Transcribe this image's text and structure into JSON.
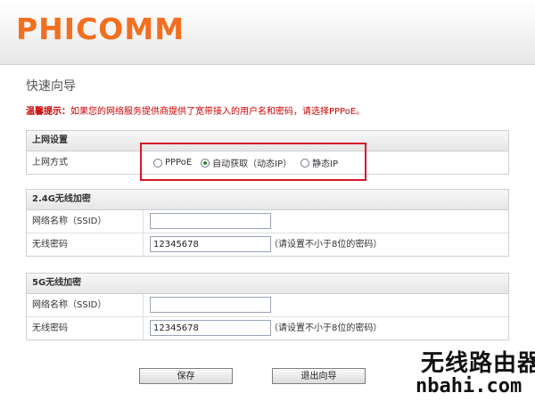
{
  "header": {
    "logo_text": "PHICOMM"
  },
  "page_title": "快速向导",
  "tip": {
    "label": "温馨提示：",
    "text": "如果您的网络服务提供商提供了宽带接入的用户名和密码，请选择PPPoE。"
  },
  "internet": {
    "title": "上网设置",
    "mode_label": "上网方式",
    "options": [
      {
        "label": "PPPoE",
        "checked": false
      },
      {
        "label": "自动获取（动态IP）",
        "checked": true
      },
      {
        "label": "静态IP",
        "checked": false
      }
    ]
  },
  "wifi24": {
    "title": "2.4G无线加密",
    "ssid_label": "网络名称（SSID）",
    "ssid_value": "",
    "password_label": "无线密码",
    "password_value": "12345678",
    "password_hint": "（请设置不小于8位的密码）"
  },
  "wifi5": {
    "title": "5G无线加密",
    "ssid_label": "网络名称（SSID）",
    "ssid_value": "",
    "password_label": "无线密码",
    "password_value": "12345678",
    "password_hint": "（请设置不小于8位的密码）"
  },
  "buttons": {
    "save": "保存",
    "exit": "退出向导"
  },
  "watermark": {
    "title": "无线路由器",
    "site": "nbahi.com"
  },
  "colors": {
    "brand": "#f26f21",
    "tip": "#cc0000",
    "highlight": "#d6162b"
  }
}
